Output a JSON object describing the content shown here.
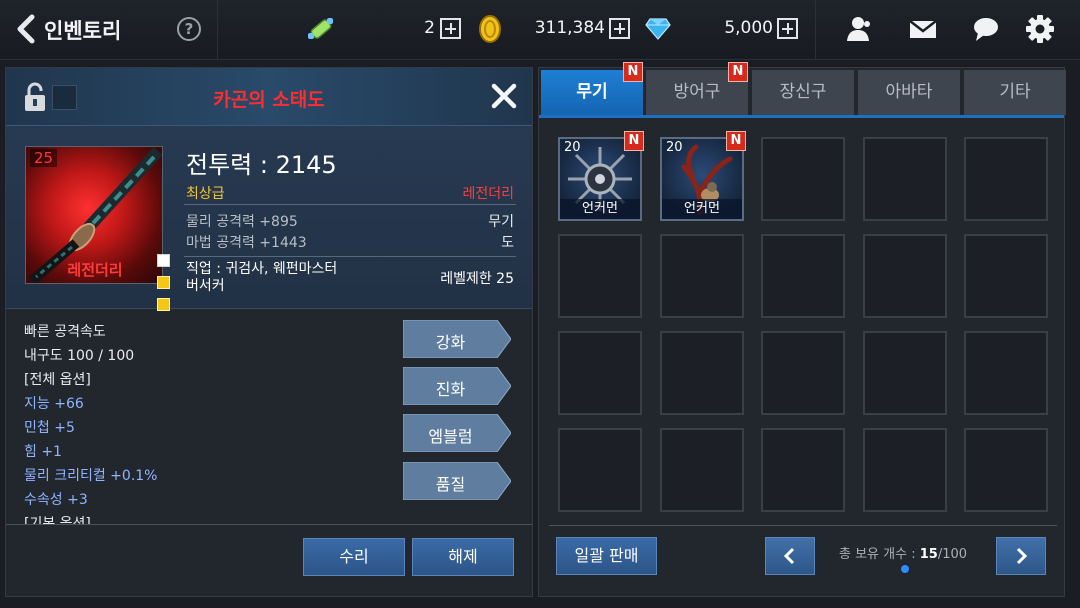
{
  "header": {
    "title": "인벤토리",
    "help_symbol": "?",
    "scroll_count": "2",
    "gold": "311,384",
    "gems": "5,000",
    "icons": [
      "back-arrow-icon",
      "help-icon",
      "scroll-icon",
      "gold-coin-icon",
      "gem-icon",
      "friends-icon",
      "mail-icon",
      "chat-icon",
      "settings-icon"
    ]
  },
  "item_detail": {
    "name": "카곤의 소태도",
    "level": "25",
    "portrait_grade": "레전더리",
    "power": "전투력 : 2145",
    "grade": "최상급",
    "grade_right": "레전더리",
    "stats": [
      {
        "label": "물리 공격력 +895",
        "right": "무기"
      },
      {
        "label": "마법 공격력 +1443",
        "right": "도"
      }
    ],
    "job": "직업 : 귀검사, 웨펀마스터\n버서커",
    "level_req": "레벨제한 25",
    "options": [
      {
        "text": "빠른 공격속도",
        "color": "white"
      },
      {
        "text": "내구도 100 / 100",
        "color": "white"
      },
      {
        "text": "[전체 옵션]",
        "color": "white"
      },
      {
        "text": "지능 +66",
        "color": "blue"
      },
      {
        "text": "민첩 +5",
        "color": "blue"
      },
      {
        "text": "힘 +1",
        "color": "blue"
      },
      {
        "text": "물리 크리티컬 +0.1%",
        "color": "blue"
      },
      {
        "text": "수속성 +3",
        "color": "blue"
      },
      {
        "text": "[기본 옵션]",
        "color": "white"
      }
    ],
    "action_buttons": [
      "강화",
      "진화",
      "엠블럼",
      "품질"
    ],
    "repair_label": "수리",
    "unequip_label": "해제",
    "slot_marks": [
      "white",
      "#f5c518",
      "#f5c518"
    ]
  },
  "inventory": {
    "tabs": [
      {
        "label": "무기",
        "active": true,
        "new": true
      },
      {
        "label": "방어구",
        "active": false,
        "new": true
      },
      {
        "label": "장신구",
        "active": false,
        "new": false
      },
      {
        "label": "아바타",
        "active": false,
        "new": false
      },
      {
        "label": "기타",
        "active": false,
        "new": false
      }
    ],
    "new_badge": "N",
    "items": [
      {
        "level": "20",
        "name": "언커먼",
        "new": true
      },
      {
        "level": "20",
        "name": "언커먼",
        "new": true
      }
    ],
    "total_slots": 20,
    "sell_all_label": "일괄 판매",
    "count_prefix": "총 보유 개수 : ",
    "count_current": "15",
    "count_max": "/100"
  },
  "colors": {
    "accent_blue": "#1e7fd4",
    "legendary_red": "#ff2d2d",
    "top_grade_gold": "#f4c430",
    "option_blue": "#8fb5ff"
  }
}
